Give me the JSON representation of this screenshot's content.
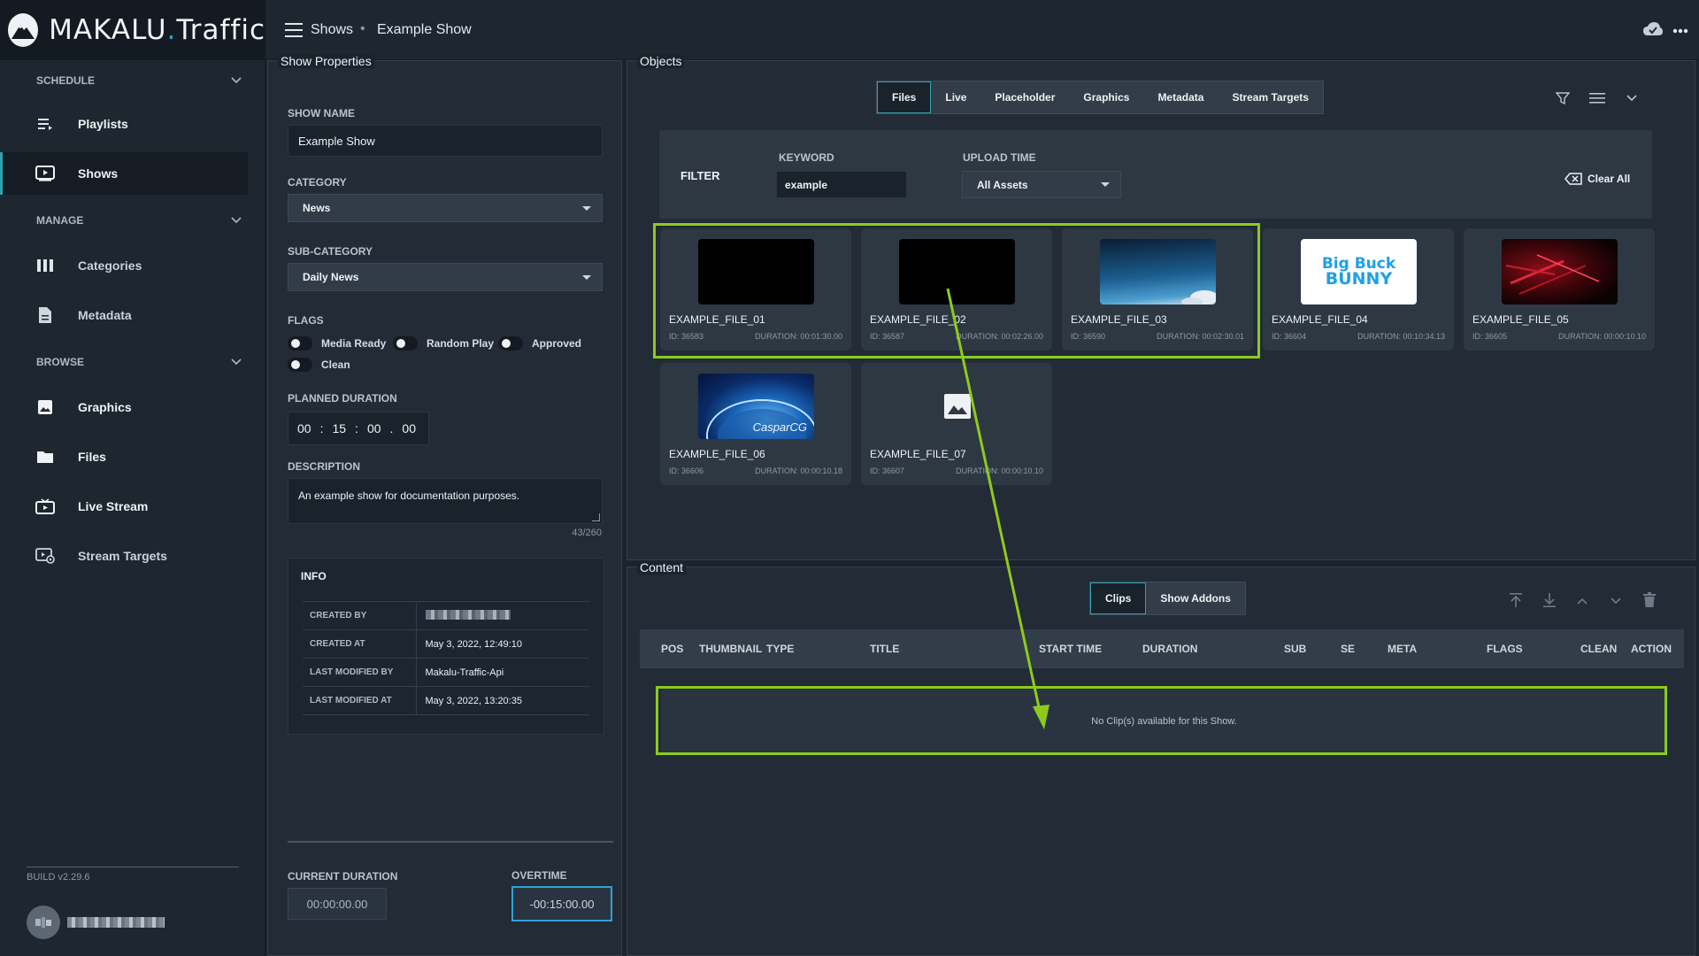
{
  "app": {
    "logo_main": "MAKALU",
    "logo_dot": ".",
    "logo_sub": "Traffic"
  },
  "breadcrumb": {
    "level1": "Shows",
    "separator": "•",
    "level2": "Example Show"
  },
  "sidebar": {
    "sections": [
      {
        "label": "SCHEDULE"
      },
      {
        "label": "MANAGE"
      },
      {
        "label": "BROWSE"
      }
    ],
    "items": [
      {
        "label": "Playlists",
        "icon": "playlist-icon"
      },
      {
        "label": "Shows",
        "icon": "play-box-icon",
        "active": true
      },
      {
        "label": "Categories",
        "icon": "columns-icon"
      },
      {
        "label": "Metadata",
        "icon": "document-icon"
      },
      {
        "label": "Graphics",
        "icon": "image-icon"
      },
      {
        "label": "Files",
        "icon": "folder-icon"
      },
      {
        "label": "Live Stream",
        "icon": "tv-icon"
      },
      {
        "label": "Stream Targets",
        "icon": "stream-target-icon"
      }
    ],
    "build": "BUILD v2.29.6"
  },
  "show_properties": {
    "title": "Show Properties",
    "show_name_label": "SHOW NAME",
    "show_name_value": "Example Show",
    "category_label": "CATEGORY",
    "category_value": "News",
    "subcategory_label": "SUB-CATEGORY",
    "subcategory_value": "Daily News",
    "flags_label": "FLAGS",
    "flags": [
      {
        "label": "Media Ready",
        "on": false
      },
      {
        "label": "Random Play",
        "on": false
      },
      {
        "label": "Approved",
        "on": false
      },
      {
        "label": "Clean",
        "on": false
      }
    ],
    "planned_label": "PLANNED DURATION",
    "planned": {
      "hh": "00",
      "mm": "15",
      "ss": "00",
      "ff": "00",
      "sep1": ":",
      "sep2": ":",
      "sep3": "."
    },
    "description_label": "DESCRIPTION",
    "description_value": "An example show for documentation purposes.",
    "description_count": "43/260",
    "info": {
      "title": "INFO",
      "rows": [
        {
          "key": "CREATED BY",
          "value": ""
        },
        {
          "key": "CREATED AT",
          "value": "May 3, 2022, 12:49:10"
        },
        {
          "key": "LAST MODIFIED BY",
          "value": "Makalu-Traffic-Api"
        },
        {
          "key": "LAST MODIFIED AT",
          "value": "May 3, 2022, 13:20:35"
        }
      ]
    },
    "current_duration_label": "CURRENT DURATION",
    "current_duration_value": "00:00:00.00",
    "overtime_label": "OVERTIME",
    "overtime_value": "-00:15:00.00"
  },
  "objects": {
    "title": "Objects",
    "tabs": [
      "Files",
      "Live",
      "Placeholder",
      "Graphics",
      "Metadata",
      "Stream Targets"
    ],
    "active_tab": "Files",
    "filter": {
      "title": "FILTER",
      "keyword_label": "KEYWORD",
      "keyword_value": "example",
      "upload_label": "UPLOAD TIME",
      "upload_value": "All Assets",
      "clear_label": "Clear All"
    },
    "files": [
      {
        "name": "EXAMPLE_FILE_01",
        "id": "ID: 36583",
        "duration": "DURATION: 00:01:30.00",
        "thumb": "black"
      },
      {
        "name": "EXAMPLE_FILE_02",
        "id": "ID: 36587",
        "duration": "DURATION: 00:02:26.00",
        "thumb": "black"
      },
      {
        "name": "EXAMPLE_FILE_03",
        "id": "ID: 36590",
        "duration": "DURATION: 00:02:30.01",
        "thumb": "sky"
      },
      {
        "name": "EXAMPLE_FILE_04",
        "id": "ID: 36604",
        "duration": "DURATION: 00:10:34.13",
        "thumb": "bigbuck",
        "thumb_text_1": "Big Buck",
        "thumb_text_2": "BUNNY"
      },
      {
        "name": "EXAMPLE_FILE_05",
        "id": "ID: 36605",
        "duration": "DURATION: 00:00:10.10",
        "thumb": "red"
      },
      {
        "name": "EXAMPLE_FILE_06",
        "id": "ID: 36606",
        "duration": "DURATION: 00:00:10.18",
        "thumb": "globe",
        "thumb_text_1": "CasparCG"
      },
      {
        "name": "EXAMPLE_FILE_07",
        "id": "ID: 36607",
        "duration": "DURATION: 00:00:10.10",
        "thumb": "placeholder"
      }
    ]
  },
  "content": {
    "title": "Content",
    "tabs": [
      "Clips",
      "Show Addons"
    ],
    "active_tab": "Clips",
    "columns": [
      "POS",
      "THUMBNAIL",
      "TYPE",
      "TITLE",
      "START TIME",
      "DURATION",
      "SUB",
      "SE",
      "META",
      "FLAGS",
      "CLEAN",
      "ACTION"
    ],
    "empty_message": "No Clip(s) available for this Show."
  },
  "colors": {
    "accent": "#2ea3ad",
    "highlight": "#8ccb1d",
    "overtime_border": "#2ea3d3"
  }
}
